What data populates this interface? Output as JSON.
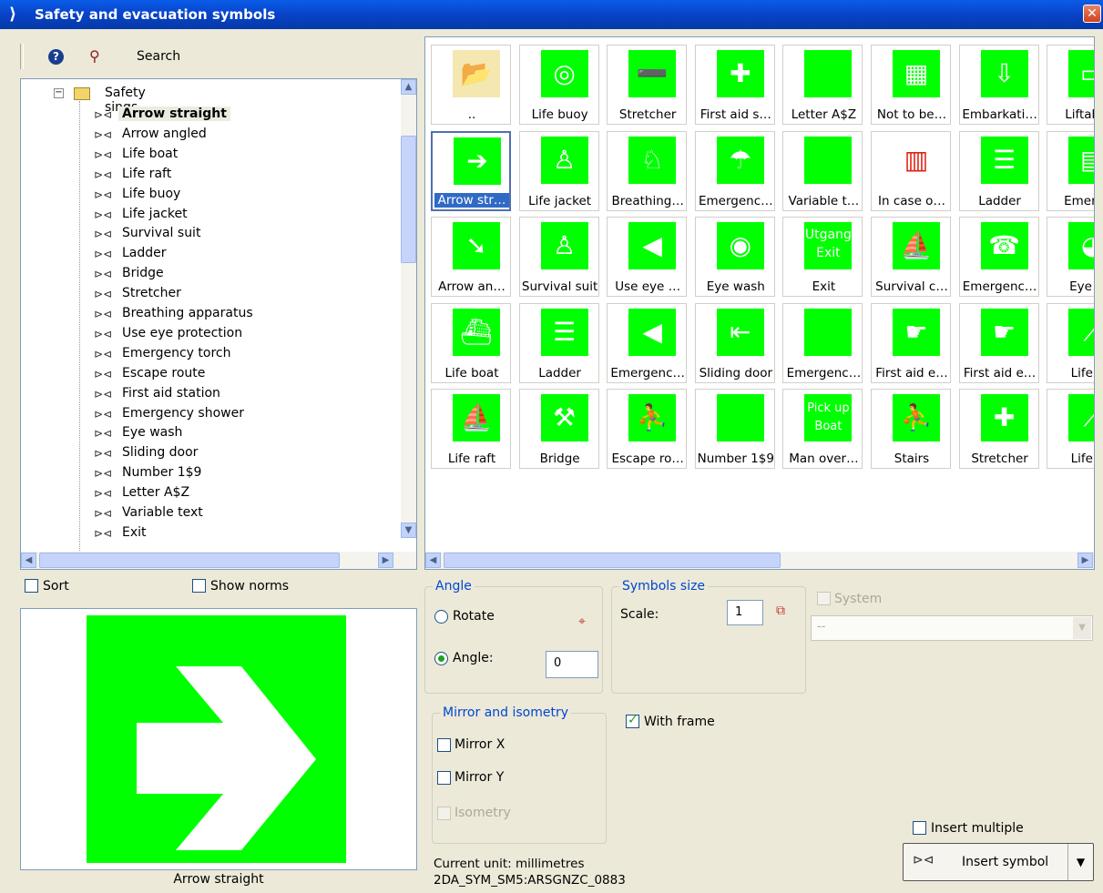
{
  "window": {
    "title": "Safety and evacuation symbols"
  },
  "toolbar": {
    "search_label": "Search"
  },
  "tree": {
    "folder": "Safety sings",
    "items": [
      "Arrow straight",
      "Arrow angled",
      "Life boat",
      "Life raft",
      "Life buoy",
      "Life jacket",
      "Survival suit",
      "Ladder",
      "Bridge",
      "Stretcher",
      "Breathing apparatus",
      "Use eye protection",
      "Emergency torch",
      "Escape route",
      "First aid station",
      "Emergency shower",
      "Eye wash",
      "Sliding door",
      "Number 1$9",
      "Letter A$Z",
      "Variable text",
      "Exit"
    ],
    "selected_index": 0
  },
  "options": {
    "sort_label": "Sort",
    "show_norms_label": "Show norms"
  },
  "preview": {
    "caption": "Arrow straight"
  },
  "grid": {
    "rows": [
      [
        "..",
        "Life buoy",
        "Stretcher",
        "First aid s…",
        "Letter A$Z",
        "Not to be…",
        "Embarkati…",
        "Liftable"
      ],
      [
        "Arrow str…",
        "Life jacket",
        "Breathing…",
        "Emergenc…",
        "Variable t…",
        "In case o…",
        "Ladder",
        "Emerge"
      ],
      [
        "Arrow an…",
        "Survival suit",
        "Use eye …",
        "Eye wash",
        "Exit",
        "Survival c…",
        "Emergenc…",
        "Eye w"
      ],
      [
        "Life boat",
        "Ladder",
        "Emergenc…",
        "Sliding door",
        "Emergenc…",
        "First aid e…",
        "First aid e…",
        "Life b"
      ],
      [
        "Life raft",
        "Bridge",
        "Escape ro…",
        "Number 1$9",
        "Man over…",
        "Stairs",
        "Stretcher",
        "Life b"
      ]
    ],
    "sign_text": {
      "exit_line1": "Utgang",
      "exit_line2": "Exit",
      "mob_line1": "Pick up",
      "mob_line2": "Boat"
    },
    "selected": [
      1,
      0
    ]
  },
  "angle": {
    "title": "Angle",
    "rotate_label": "Rotate",
    "angle_label": "Angle:",
    "angle_value": "0"
  },
  "size": {
    "title": "Symbols size",
    "scale_label": "Scale:",
    "scale_value": "1"
  },
  "system": {
    "label": "System",
    "combo_value": "--"
  },
  "mirror": {
    "title": "Mirror and isometry",
    "mirror_x": "Mirror X",
    "mirror_y": "Mirror Y",
    "isometry": "Isometry"
  },
  "frame": {
    "label": "With frame"
  },
  "insert": {
    "multiple_label": "Insert multiple",
    "button_label": "Insert symbol"
  },
  "status": {
    "unit": "Current unit: millimetres",
    "code": "2DA_SYM_SM5:ARSGNZC_0883"
  },
  "colors": {
    "sign_green": "#00ff00",
    "titlebar": "#0842c8",
    "accent_blue": "#0046d5"
  }
}
